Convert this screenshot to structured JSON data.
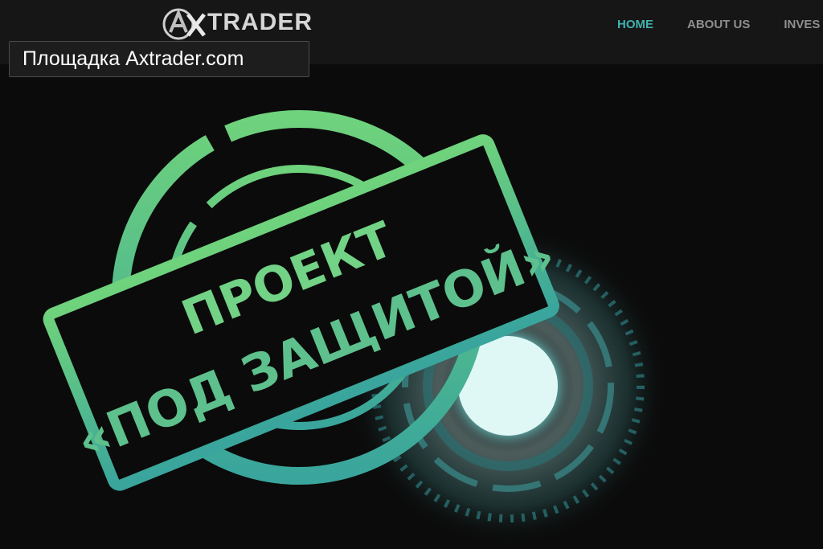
{
  "header": {
    "logo_text": "TRADER",
    "logo_mark": "AX",
    "nav": [
      {
        "label": "HOME",
        "active": true
      },
      {
        "label": "ABOUT US",
        "active": false
      },
      {
        "label": "INVES",
        "active": false
      }
    ]
  },
  "caption": {
    "text": "Площадка Axtrader.com"
  },
  "stamp": {
    "line1": "ПРОЕКТ",
    "line2": "«ПОД ЗАЩИТОЙ»",
    "color": "#5fc98a",
    "color_dark": "#3aa59c"
  },
  "hero": {
    "glow_color": "#9ee6e2",
    "ring_color": "#2a6f72"
  },
  "icons": [
    "axtrader-logo-icon",
    "glowing-orb-icon",
    "stamp-frame-icon"
  ]
}
